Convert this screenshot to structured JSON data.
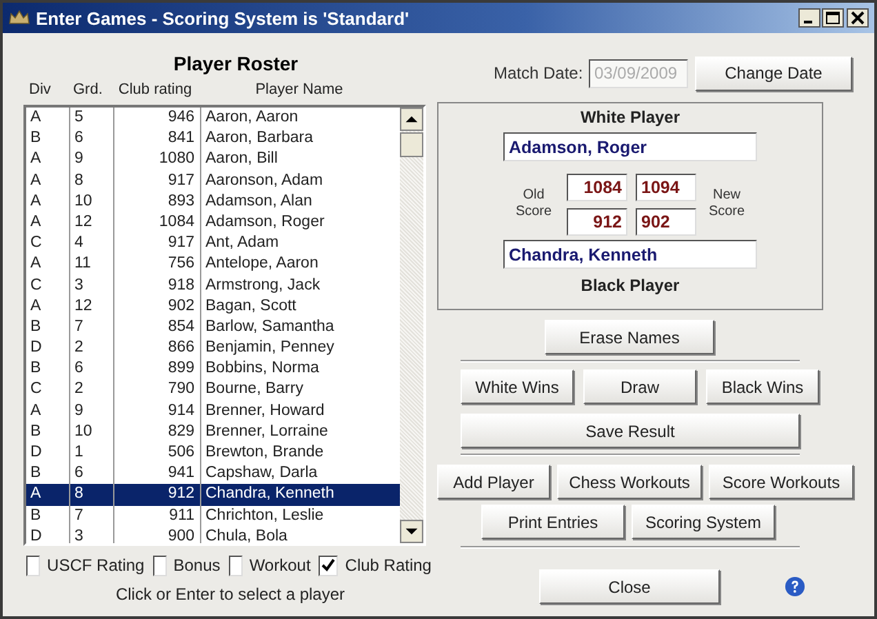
{
  "window": {
    "title": "Enter Games - Scoring System is 'Standard'"
  },
  "roster": {
    "title": "Player Roster",
    "columns": [
      "Div",
      "Grd.",
      "Club rating",
      "Player Name"
    ],
    "rows": [
      {
        "cells": [
          "A",
          "5",
          "946",
          "Aaron, Aaron"
        ],
        "selected": false
      },
      {
        "cells": [
          "B",
          "6",
          "841",
          "Aaron, Barbara"
        ],
        "selected": false
      },
      {
        "cells": [
          "A",
          "9",
          "1080",
          "Aaron, Bill"
        ],
        "selected": false
      },
      {
        "cells": [
          "A",
          "8",
          "917",
          "Aaronson, Adam"
        ],
        "selected": false
      },
      {
        "cells": [
          "A",
          "10",
          "893",
          "Adamson, Alan"
        ],
        "selected": false
      },
      {
        "cells": [
          "A",
          "12",
          "1084",
          "Adamson, Roger"
        ],
        "selected": false
      },
      {
        "cells": [
          "C",
          "4",
          "917",
          "Ant, Adam"
        ],
        "selected": false
      },
      {
        "cells": [
          "A",
          "11",
          "756",
          "Antelope, Aaron"
        ],
        "selected": false
      },
      {
        "cells": [
          "C",
          "3",
          "918",
          "Armstrong, Jack"
        ],
        "selected": false
      },
      {
        "cells": [
          "A",
          "12",
          "902",
          "Bagan, Scott"
        ],
        "selected": false
      },
      {
        "cells": [
          "B",
          "7",
          "854",
          "Barlow, Samantha"
        ],
        "selected": false
      },
      {
        "cells": [
          "D",
          "2",
          "866",
          "Benjamin, Penney"
        ],
        "selected": false
      },
      {
        "cells": [
          "B",
          "6",
          "899",
          "Bobbins, Norma"
        ],
        "selected": false
      },
      {
        "cells": [
          "C",
          "2",
          "790",
          "Bourne, Barry"
        ],
        "selected": false
      },
      {
        "cells": [
          "A",
          "9",
          "914",
          "Brenner, Howard"
        ],
        "selected": false
      },
      {
        "cells": [
          "B",
          "10",
          "829",
          "Brenner, Lorraine"
        ],
        "selected": false
      },
      {
        "cells": [
          "D",
          "1",
          "506",
          "Brewton, Brande"
        ],
        "selected": false
      },
      {
        "cells": [
          "B",
          "6",
          "941",
          "Capshaw, Darla"
        ],
        "selected": false
      },
      {
        "cells": [
          "A",
          "8",
          "912",
          "Chandra, Kenneth"
        ],
        "selected": true
      },
      {
        "cells": [
          "B",
          "7",
          "911",
          "Chrichton, Leslie"
        ],
        "selected": false
      },
      {
        "cells": [
          "D",
          "3",
          "900",
          "Chula, Bola"
        ],
        "selected": false
      }
    ]
  },
  "options": [
    {
      "label": "USCF Rating",
      "checked": false
    },
    {
      "label": "Bonus",
      "checked": false
    },
    {
      "label": "Workout",
      "checked": false
    },
    {
      "label": "Club Rating",
      "checked": true
    }
  ],
  "hint": "Click or Enter to select a player",
  "match_date": {
    "label": "Match Date:",
    "value": "03/09/2009",
    "disabled": true
  },
  "change_date": "Change Date",
  "game": {
    "white_label": "White Player",
    "white_player": "Adamson, Roger",
    "old_label": "Old Score",
    "new_label": "New Score",
    "white_old": "1084",
    "white_new": "1094",
    "black_old": "912",
    "black_new": "902",
    "black_player": "Chandra, Kenneth",
    "black_label": "Black Player"
  },
  "erase": "Erase Names",
  "results": [
    "White Wins",
    "Draw",
    "Black Wins"
  ],
  "save": "Save Result",
  "tools": [
    "Add Player",
    "Chess Workouts",
    "Score Workouts"
  ],
  "tools_2": [
    "Print Entries",
    "Scoring System"
  ],
  "close": "Close"
}
